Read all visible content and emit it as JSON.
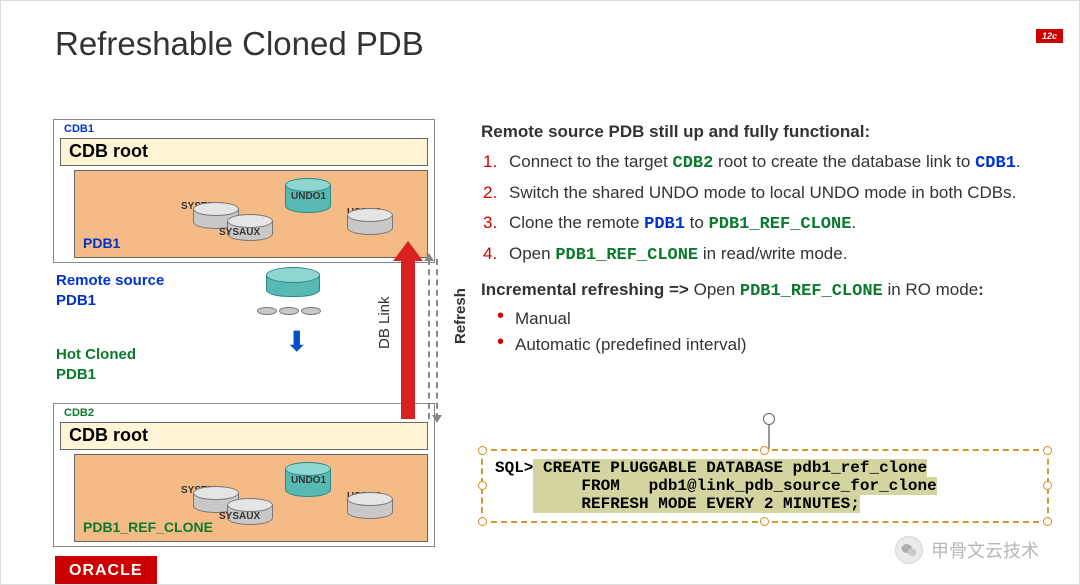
{
  "title": "Refreshable Cloned PDB",
  "badge": "12c",
  "diagram": {
    "cdb1": {
      "label": "CDB1",
      "root": "CDB root",
      "pdb": "PDB1",
      "undo": "UNDO1",
      "ts1": "SYSTEM",
      "ts2": "SYSAUX",
      "ts3": "USERS"
    },
    "cdb2": {
      "label": "CDB2",
      "root": "CDB root",
      "pdb": "PDB1_REF_CLONE",
      "undo": "UNDO1",
      "ts1": "SYSTEM",
      "ts2": "SYSAUX",
      "ts3": "USERS"
    },
    "remote_source": "Remote source\nPDB1",
    "hot_cloned": "Hot Cloned\nPDB1",
    "dblink": "DB Link",
    "refresh": "Refresh"
  },
  "content": {
    "heading1": "Remote source PDB still up and fully functional:",
    "steps": [
      {
        "n": "1.",
        "pre": "Connect to the target ",
        "code": "CDB2",
        "post": " root to create the database link to ",
        "code2": "CDB1",
        "post2": "."
      },
      {
        "n": "2.",
        "pre": "Switch the shared UNDO mode to local UNDO mode in both CDBs."
      },
      {
        "n": "3.",
        "pre": "Clone the remote ",
        "code": "PDB1",
        "mid": " to ",
        "code2": "PDB1_REF_CLONE",
        "post2": "."
      },
      {
        "n": "4.",
        "pre": "Open ",
        "code": "PDB1_REF_CLONE",
        "post": " in read/write mode."
      }
    ],
    "heading2_a": "Incremental refreshing => ",
    "heading2_b": "Open ",
    "heading2_code": "PDB1_REF_CLONE",
    "heading2_c": " in RO mode",
    "heading2_colon": ":",
    "bullets": [
      "Manual",
      "Automatic (predefined interval)"
    ]
  },
  "sql": {
    "prompt": "SQL>",
    "l1": " CREATE PLUGGABLE DATABASE pdb1_ref_clone",
    "l2": "     FROM   pdb1@link_pdb_source_for_clone",
    "l3": "     REFRESH MODE EVERY 2 MINUTES;"
  },
  "footer": {
    "oracle": "ORACLE"
  },
  "watermark": "甲骨文云技术"
}
